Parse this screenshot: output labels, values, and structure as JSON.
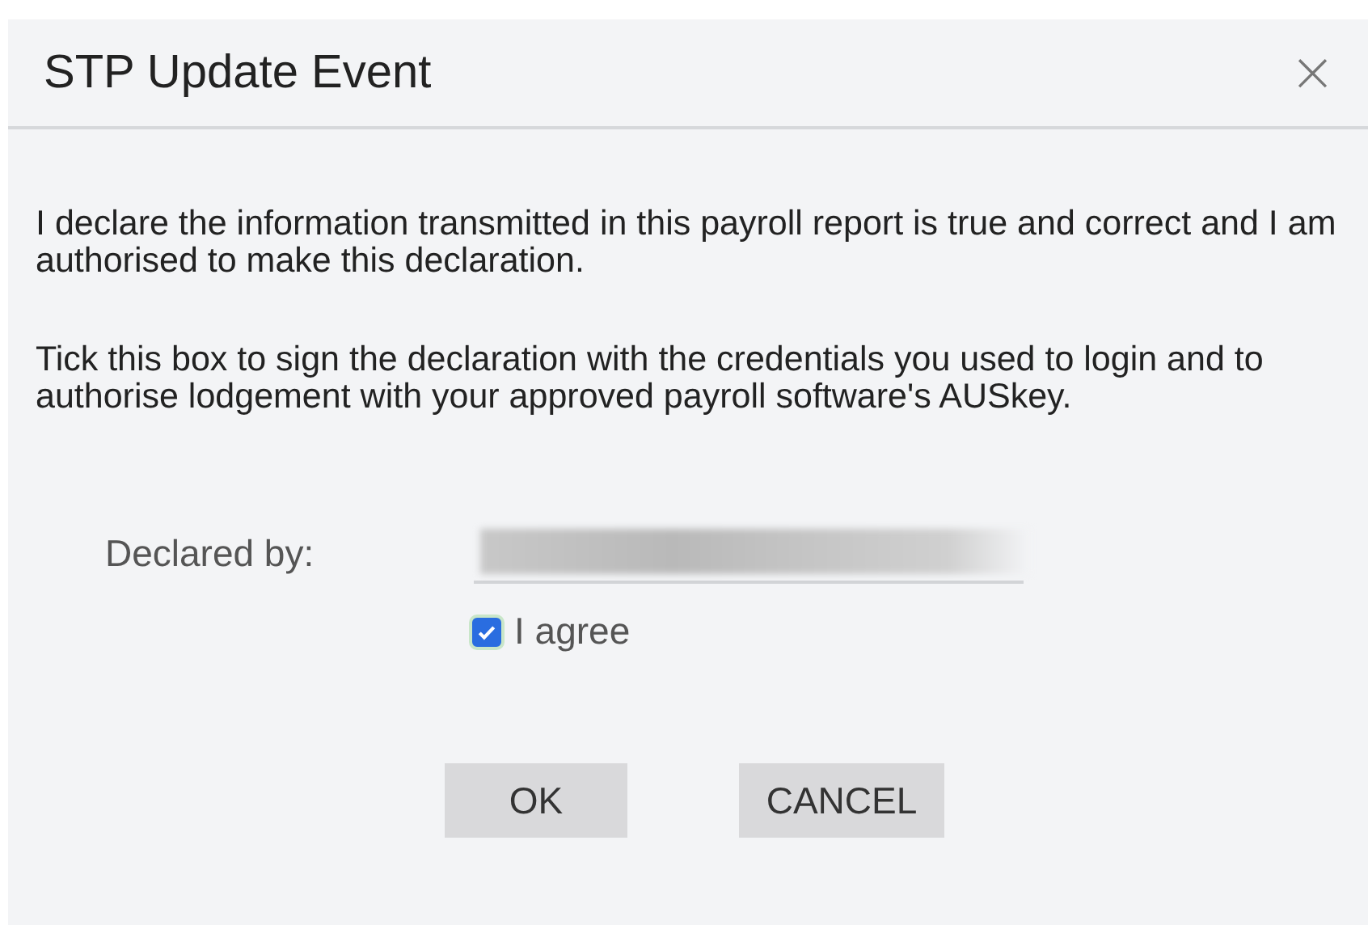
{
  "dialog": {
    "title": "STP Update Event",
    "close": "×"
  },
  "paragraphs": [
    "I declare the information transmitted in this payroll report is true and correct and I am authorised to make this declaration.",
    "Tick this box to sign the declaration with the credentials you used to login and to authorise lodgement with your approved payroll software's AUSkey."
  ],
  "declared_by": {
    "label": "Declared by:",
    "value_redacted": true
  },
  "agree": {
    "label": "I agree",
    "checked": true
  },
  "buttons": [
    "OK",
    "CANCEL"
  ]
}
